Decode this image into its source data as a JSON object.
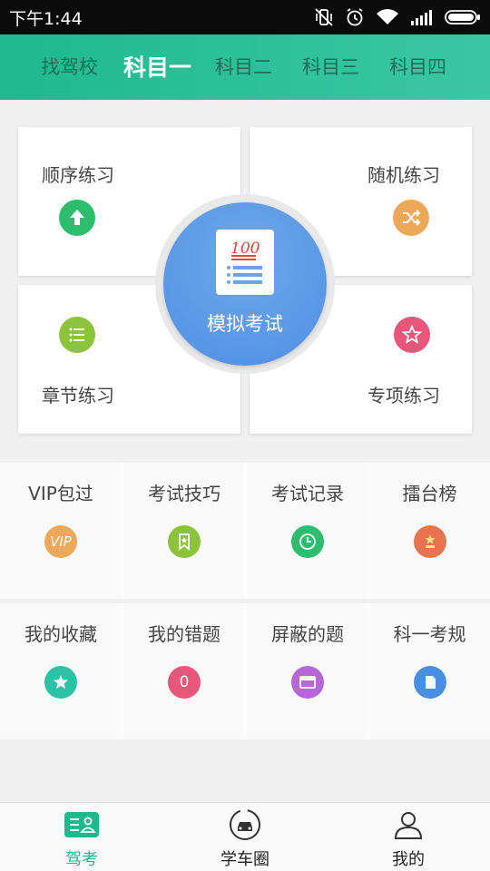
{
  "status_bar": {
    "time": "下午1:44"
  },
  "tabs": [
    {
      "label": "找驾校"
    },
    {
      "label": "科目一"
    },
    {
      "label": "科目二"
    },
    {
      "label": "科目三"
    },
    {
      "label": "科目四"
    }
  ],
  "active_tab": "科目一",
  "practice": {
    "sequential": {
      "label": "顺序练习",
      "icon": "arrow-up-icon",
      "color": "#2ebd6f"
    },
    "random": {
      "label": "随机练习",
      "icon": "shuffle-icon",
      "color": "#eda85a"
    },
    "chapter": {
      "label": "章节练习",
      "icon": "list-icon",
      "color": "#8bc43c"
    },
    "special": {
      "label": "专项练习",
      "icon": "star-icon",
      "color": "#e8577a"
    }
  },
  "mock_exam": {
    "label": "模拟考试",
    "paper_score": "100",
    "color": "#5b97e6"
  },
  "grid_row1": [
    {
      "label": "VIP包过",
      "icon": "vip-icon",
      "icon_text": "VIP",
      "color": "#eda85a"
    },
    {
      "label": "考试技巧",
      "icon": "bookmark-icon",
      "color": "#8bc43c"
    },
    {
      "label": "考试记录",
      "icon": "clock-icon",
      "color": "#2ebd6f"
    },
    {
      "label": "擂台榜",
      "icon": "trophy-icon",
      "color": "#e8734f"
    }
  ],
  "grid_row2": [
    {
      "label": "我的收藏",
      "icon": "star-icon",
      "color": "#2bc3a4"
    },
    {
      "label": "我的错题",
      "icon": "error-count-icon",
      "icon_text": "0",
      "color": "#e8577a"
    },
    {
      "label": "屏蔽的题",
      "icon": "window-icon",
      "color": "#b666d6"
    },
    {
      "label": "科一考规",
      "icon": "rules-doc-icon",
      "color": "#4a8ee0"
    }
  ],
  "bottom_nav": [
    {
      "label": "驾考",
      "icon": "driving-test-icon"
    },
    {
      "label": "学车圈",
      "icon": "car-circle-icon"
    },
    {
      "label": "我的",
      "icon": "person-icon"
    }
  ],
  "colors": {
    "accent": "#1db88c",
    "header_gradient": [
      "#1fb98e",
      "#39c7a5"
    ]
  }
}
